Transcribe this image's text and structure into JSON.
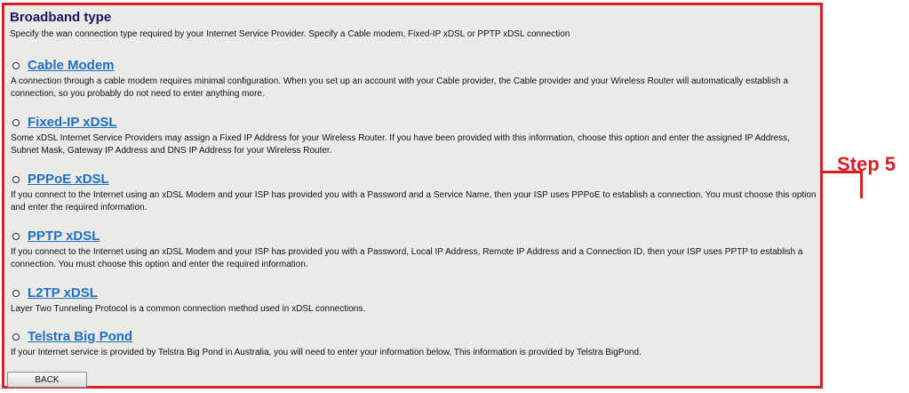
{
  "header": {
    "title": "Broadband type",
    "description": "Specify the wan connection type required by your Internet Service Provider. Specify a Cable modem, Fixed-IP xDSL or PPTP xDSL connection"
  },
  "options": [
    {
      "label": "Cable Modem",
      "description": "A connection through a cable modem requires minimal configuration. When you set up an account with your Cable provider, the Cable provider and your Wireless Router will automatically establish a connection, so you probably do not need to enter anything more."
    },
    {
      "label": "Fixed-IP xDSL",
      "description": "Some xDSL Internet Service Providers may assign a Fixed IP Address for your Wireless Router. If you have been provided with this information, choose this option and enter the assigned IP Address, Subnet Mask, Gateway IP Address and DNS IP Address for your Wireless Router."
    },
    {
      "label": "PPPoE xDSL",
      "description": "If you connect to the Internet using an xDSL Modem and your ISP has provided you with a Password and a Service Name, then your ISP uses PPPoE to establish a connection. You must choose this option and enter the required information."
    },
    {
      "label": "PPTP xDSL",
      "description": "If you connect to the Internet using an xDSL Modem and your ISP has provided you with a Password, Local IP Address, Remote IP Address and a Connection ID, then your ISP uses PPTP to establish a connection. You must choose this option and enter the required information."
    },
    {
      "label": "L2TP xDSL",
      "description": "Layer Two Tunneling Protocol is a common connection method used in xDSL connections."
    },
    {
      "label": "Telstra Big Pond",
      "description": "If your Internet service is provided by Telstra Big Pond in Australia, you will need to enter your information below, This information is provided by Telstra BigPond."
    }
  ],
  "buttons": {
    "back_label": "BACK"
  },
  "annotation": {
    "step_label": "Step 5"
  },
  "colors": {
    "highlight_red": "#d61f26",
    "link_blue": "#1f6fc1",
    "panel_bg": "#eceae7"
  }
}
